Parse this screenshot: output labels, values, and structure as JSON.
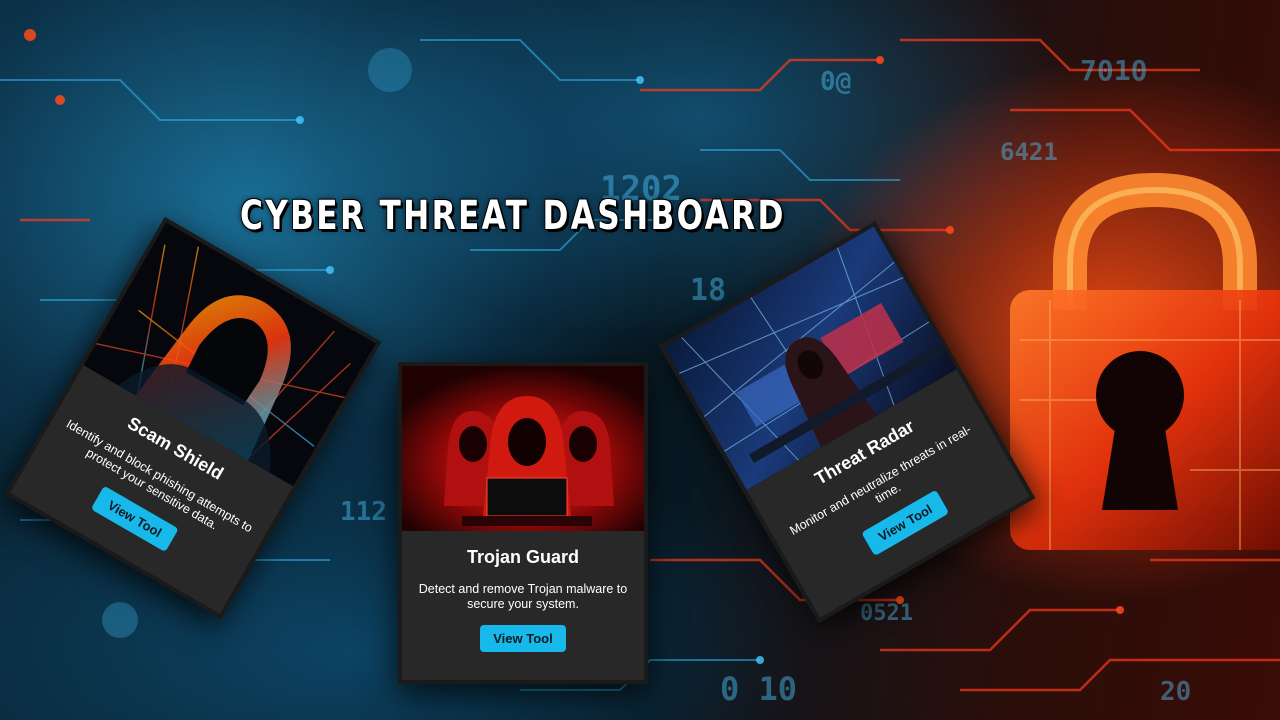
{
  "page": {
    "title": "CYBER THREAT DASHBOARD"
  },
  "cards": [
    {
      "title": "Scam Shield",
      "description": "Identify and block phishing attempts to protect your sensitive data.",
      "button_label": "View Tool",
      "image": "hooded-hacker-neon-image"
    },
    {
      "title": "Trojan Guard",
      "description": "Detect and remove Trojan malware to secure your system.",
      "button_label": "View Tool",
      "image": "red-hooded-hackers-image"
    },
    {
      "title": "Threat Radar",
      "description": "Monitor and neutralize threats in real-time.",
      "button_label": "View Tool",
      "image": "hacker-monitors-image"
    }
  ],
  "colors": {
    "button": "#17b9ea",
    "card_bg": "#282828",
    "accent_blue": "#28aae6",
    "accent_red": "#ff3c14"
  }
}
